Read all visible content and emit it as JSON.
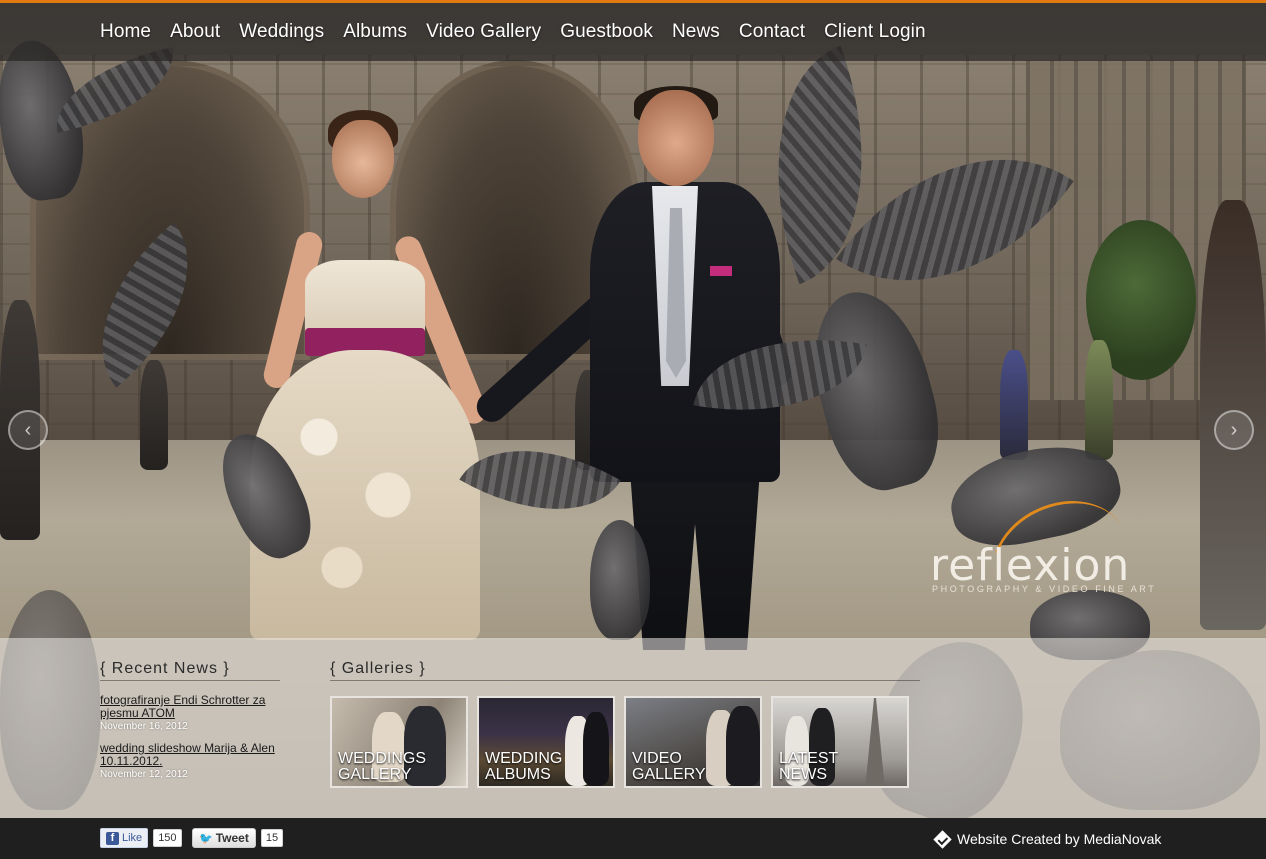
{
  "nav": {
    "items": [
      {
        "label": "Home"
      },
      {
        "label": "About"
      },
      {
        "label": "Weddings"
      },
      {
        "label": "Albums"
      },
      {
        "label": "Video Gallery"
      },
      {
        "label": "Guestbook"
      },
      {
        "label": "News"
      },
      {
        "label": "Contact"
      },
      {
        "label": "Client Login"
      }
    ]
  },
  "brand": {
    "name": "reflexion",
    "tagline": "PHOTOGRAPHY & VIDEO FINE ART",
    "accent": "#e07a10"
  },
  "slider": {
    "prev_icon": "arrow-left-icon",
    "next_icon": "arrow-right-icon",
    "prev_glyph": "‹",
    "next_glyph": "›"
  },
  "recent_news": {
    "title": "{ Recent News }",
    "items": [
      {
        "title": "fotografiranje Endi Schrotter za pjesmu ATOM",
        "date": "November 16, 2012"
      },
      {
        "title": "wedding slideshow Marija & Alen 10.11.2012.",
        "date": "November 12, 2012"
      }
    ]
  },
  "galleries": {
    "title": "{ Galleries }",
    "items": [
      {
        "line1": "WEDDINGS",
        "line2": "GALLERY"
      },
      {
        "line1": "WEDDING",
        "line2": "ALBUMS"
      },
      {
        "line1": "VIDEO",
        "line2": "GALLERY"
      },
      {
        "line1": "LATEST",
        "line2": "NEWS"
      }
    ]
  },
  "footer": {
    "fb_label": "Like",
    "fb_glyph": "f",
    "fb_count": "150",
    "tw_label": "Tweet",
    "tw_count": "15",
    "credit": "Website Created by MediaNovak"
  }
}
